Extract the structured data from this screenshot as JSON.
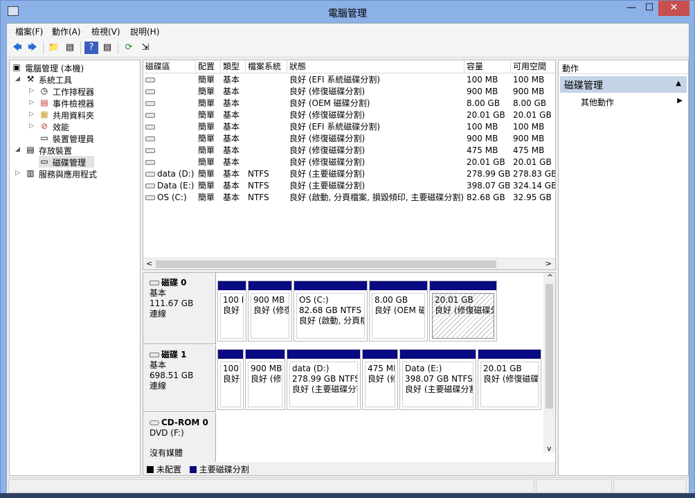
{
  "window": {
    "title": "電腦管理",
    "min_glyph": "—",
    "max_glyph": "☐",
    "close_glyph": "✕"
  },
  "menu": [
    "檔案(F)",
    "動作(A)",
    "檢視(V)",
    "說明(H)"
  ],
  "toolbar": {
    "back": "🡄",
    "forward": "🡆",
    "up_folder": "📁",
    "show_hide": "▤",
    "help": "?",
    "show_hide2": "▤",
    "refresh": "⟳",
    "export": "⇲"
  },
  "tree": {
    "root": "電腦管理 (本機)",
    "system_tools": "系統工具",
    "task_scheduler": "工作排程器",
    "event_viewer": "事件檢視器",
    "shared_folders": "共用資料夾",
    "performance": "效能",
    "device_manager": "裝置管理員",
    "storage": "存放裝置",
    "disk_management": "磁碟管理",
    "services_apps": "服務與應用程式"
  },
  "volume_table": {
    "headers": [
      "磁碟區",
      "配置",
      "類型",
      "檔案系統",
      "狀態",
      "容量",
      "可用空間"
    ],
    "rows": [
      [
        "",
        "簡單",
        "基本",
        "",
        "良好 (EFI 系統磁碟分割)",
        "100 MB",
        "100 MB"
      ],
      [
        "",
        "簡單",
        "基本",
        "",
        "良好 (修復磁碟分割)",
        "900 MB",
        "900 MB"
      ],
      [
        "",
        "簡單",
        "基本",
        "",
        "良好 (OEM 磁碟分割)",
        "8.00 GB",
        "8.00 GB"
      ],
      [
        "",
        "簡單",
        "基本",
        "",
        "良好 (修復磁碟分割)",
        "20.01 GB",
        "20.01 GB"
      ],
      [
        "",
        "簡單",
        "基本",
        "",
        "良好 (EFI 系統磁碟分割)",
        "100 MB",
        "100 MB"
      ],
      [
        "",
        "簡單",
        "基本",
        "",
        "良好 (修復磁碟分割)",
        "900 MB",
        "900 MB"
      ],
      [
        "",
        "簡單",
        "基本",
        "",
        "良好 (修復磁碟分割)",
        "475 MB",
        "475 MB"
      ],
      [
        "",
        "簡單",
        "基本",
        "",
        "良好 (修復磁碟分割)",
        "20.01 GB",
        "20.01 GB"
      ],
      [
        "data (D:)",
        "簡單",
        "基本",
        "NTFS",
        "良好 (主要磁碟分割)",
        "278.99 GB",
        "278.83 GB"
      ],
      [
        "Data (E:)",
        "簡單",
        "基本",
        "NTFS",
        "良好 (主要磁碟分割)",
        "398.07 GB",
        "324.14 GB"
      ],
      [
        "OS (C:)",
        "簡單",
        "基本",
        "NTFS",
        "良好 (啟動, 分頁檔案, 損毀傾印, 主要磁碟分割)",
        "82.68 GB",
        "32.95 GB"
      ]
    ]
  },
  "disks": [
    {
      "name": "磁碟 0",
      "type": "基本",
      "size": "111.67 GB",
      "status": "連線",
      "partitions": [
        {
          "title": "",
          "line1": "100 MB",
          "line2": "良好"
        },
        {
          "title": "",
          "line1": "900 MB",
          "line2": "良好 (修復"
        },
        {
          "title": "OS  (C:)",
          "line1": "82.68 GB NTFS",
          "line2": "良好 (啟動, 分頁檔"
        },
        {
          "title": "",
          "line1": "8.00 GB",
          "line2": "良好 (OEM 磁"
        },
        {
          "title": "",
          "line1": "20.01 GB",
          "line2": "良好 (修復磁碟分"
        }
      ]
    },
    {
      "name": "磁碟 1",
      "type": "基本",
      "size": "698.51 GB",
      "status": "連線",
      "partitions": [
        {
          "title": "",
          "line1": "100",
          "line2": "良好"
        },
        {
          "title": "",
          "line1": "900 MB",
          "line2": "良好 (修"
        },
        {
          "title": "data  (D:)",
          "line1": "278.99 GB NTFS",
          "line2": "良好 (主要磁碟分割"
        },
        {
          "title": "",
          "line1": "475 MB",
          "line2": "良好 (修"
        },
        {
          "title": "Data  (E:)",
          "line1": "398.07 GB NTFS",
          "line2": "良好 (主要磁碟分割"
        },
        {
          "title": "",
          "line1": "20.01 GB",
          "line2": "良好 (修復磁碟"
        }
      ]
    },
    {
      "name": "CD-ROM 0",
      "type": "DVD (F:)",
      "size": "",
      "status": "沒有媒體"
    }
  ],
  "legend": {
    "unallocated": "未配置",
    "primary": "主要磁碟分割",
    "unallocated_color": "#000000",
    "primary_color": "#0a0a82"
  },
  "actions": {
    "title": "動作",
    "section": "磁碟管理",
    "more": "其他動作",
    "section_arrow": "▲",
    "more_arrow": "▶"
  },
  "icons": {
    "tree_expanded": "◢",
    "tree_collapsed": "▷",
    "hscroll_left": "<",
    "hscroll_right": ">",
    "vscroll_up": "^",
    "vscroll_down": "v"
  }
}
